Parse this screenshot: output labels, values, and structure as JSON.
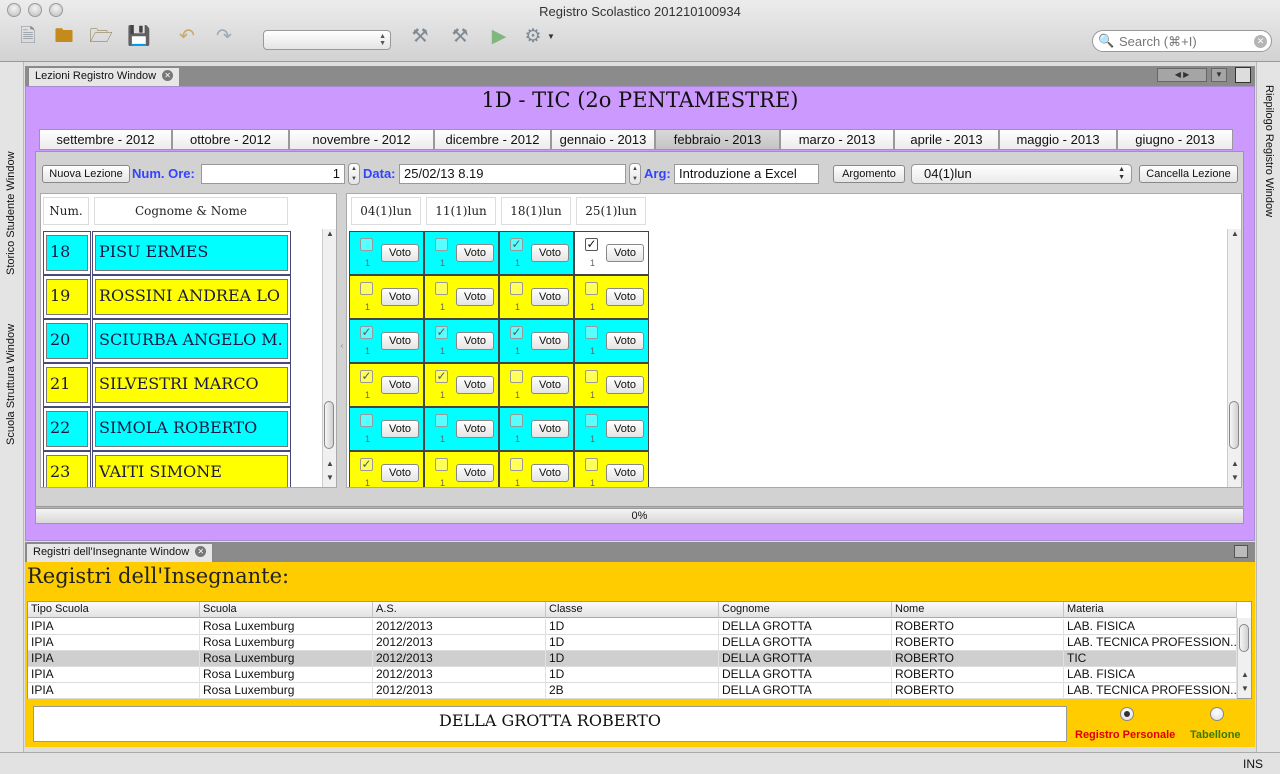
{
  "window": {
    "title": "Registro Scolastico 201210100934"
  },
  "toolbar": {
    "search_placeholder": "Search (⌘+I)"
  },
  "side_panels": {
    "left": [
      "Storico Studente Window",
      "Scuola Struttura Window"
    ],
    "right": "Riepilogo Registro Window"
  },
  "lessons_window": {
    "tab_label": "Lezioni Registro Window",
    "heading": "1D - TIC (2o PENTAMESTRE)",
    "months": [
      "settembre - 2012",
      "ottobre - 2012",
      "novembre - 2012",
      "dicembre - 2012",
      "gennaio - 2013",
      "febbraio - 2013",
      "marzo - 2013",
      "aprile - 2013",
      "maggio - 2013",
      "giugno - 2013"
    ],
    "selected_month": "febbraio - 2013",
    "form": {
      "new_lesson_button": "Nuova Lezione",
      "hours_label": "Num. Ore:",
      "hours_value": "1",
      "date_label": "Data:",
      "date_value": "25/02/13 8.19",
      "arg_label": "Arg:",
      "arg_value": "Introduzione a Excel",
      "argument_button": "Argomento",
      "lesson_select": "04(1)lun",
      "delete_button": "Cancella Lezione"
    },
    "student_columns": [
      "Num.",
      "Cognome & Nome"
    ],
    "lesson_columns": [
      "04(1)lun",
      "11(1)lun",
      "18(1)lun",
      "25(1)lun"
    ],
    "vote_button": "Voto",
    "hours_in_cell": "1",
    "students": [
      {
        "num": "18",
        "name": "PISU ERMES",
        "color": "cyan",
        "present": [
          false,
          false,
          true,
          true
        ]
      },
      {
        "num": "19",
        "name": "ROSSINI ANDREA LO",
        "color": "yellow",
        "present": [
          false,
          false,
          false,
          false
        ]
      },
      {
        "num": "20",
        "name": "SCIURBA ANGELO M.",
        "color": "cyan",
        "present": [
          true,
          true,
          true,
          false
        ]
      },
      {
        "num": "21",
        "name": "SILVESTRI MARCO",
        "color": "yellow",
        "present": [
          true,
          true,
          false,
          false
        ]
      },
      {
        "num": "22",
        "name": "SIMOLA ROBERTO",
        "color": "cyan",
        "present": [
          false,
          false,
          false,
          false
        ]
      },
      {
        "num": "23",
        "name": "VAITI SIMONE",
        "color": "yellow",
        "present": [
          true,
          false,
          false,
          false
        ]
      }
    ],
    "progress_percent": 0,
    "progress_label": "0%"
  },
  "teacher_window": {
    "tab_label": "Registri dell'Insegnante Window",
    "heading": "Registri dell'Insegnante:",
    "columns": [
      "Tipo Scuola",
      "Scuola",
      "A.S.",
      "Classe",
      "Cognome",
      "Nome",
      "Materia"
    ],
    "rows": [
      [
        "IPIA",
        "Rosa Luxemburg",
        "2012/2013",
        "1D",
        "DELLA GROTTA",
        "ROBERTO",
        "LAB. FISICA"
      ],
      [
        "IPIA",
        "Rosa Luxemburg",
        "2012/2013",
        "1D",
        "DELLA GROTTA",
        "ROBERTO",
        "LAB. TECNICA PROFESSION..."
      ],
      [
        "IPIA",
        "Rosa Luxemburg",
        "2012/2013",
        "1D",
        "DELLA GROTTA",
        "ROBERTO",
        "TIC"
      ],
      [
        "IPIA",
        "Rosa Luxemburg",
        "2012/2013",
        "1D",
        "DELLA GROTTA",
        "ROBERTO",
        "LAB. FISICA"
      ],
      [
        "IPIA",
        "Rosa Luxemburg",
        "2012/2013",
        "2B",
        "DELLA GROTTA",
        "ROBERTO",
        "LAB. TECNICA PROFESSION..."
      ]
    ],
    "selected_row": 2,
    "teacher_name": "DELLA GROTTA ROBERTO",
    "radio_personal": "Registro Personale",
    "radio_board": "Tabellone",
    "selected_radio": "Registro Personale"
  },
  "statusbar": {
    "mode": "INS"
  },
  "colors": {
    "lesson_bg": "#cc99ff",
    "teacher_bg": "#ffcc00",
    "row_cyan": "#00ffff",
    "row_yellow": "#ffff00",
    "label_blue": "#3344ff",
    "radio_red": "#dd0000",
    "radio_green": "#3a7a00"
  }
}
